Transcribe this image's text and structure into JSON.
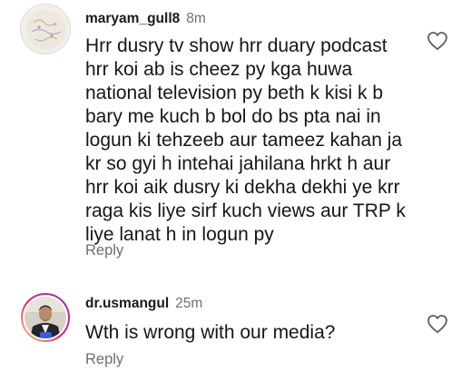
{
  "comments": [
    {
      "username": "maryam_gull8",
      "time": "8m",
      "lines": [
        "Hrr dusry tv show hrr duary podcast",
        "hrr koi ab is cheez py kga huwa",
        "national television py beth k kisi k b",
        "bary me kuch b bol do bs pta nai in",
        "logun ki tehzeeb aur tameez kahan ja",
        "kr so gyi h intehai jahilana hrkt h aur",
        "hrr koi aik dusry ki dekha dekhi ye krr",
        "raga kis liye sirf kuch views aur TRP k",
        "liye lanat h in logun py"
      ],
      "reply_label": "Reply",
      "like_icon": "heart-outline-icon"
    },
    {
      "username": "dr.usmangul",
      "time": "25m",
      "text": "Wth is wrong with our media?",
      "reply_label": "Reply",
      "like_icon": "heart-outline-icon"
    }
  ],
  "colors": {
    "text": "#161616",
    "muted": "#6f6f6f",
    "story_ring_start": "#feda75",
    "story_ring_mid": "#d62976",
    "story_ring_end": "#962fbf"
  }
}
